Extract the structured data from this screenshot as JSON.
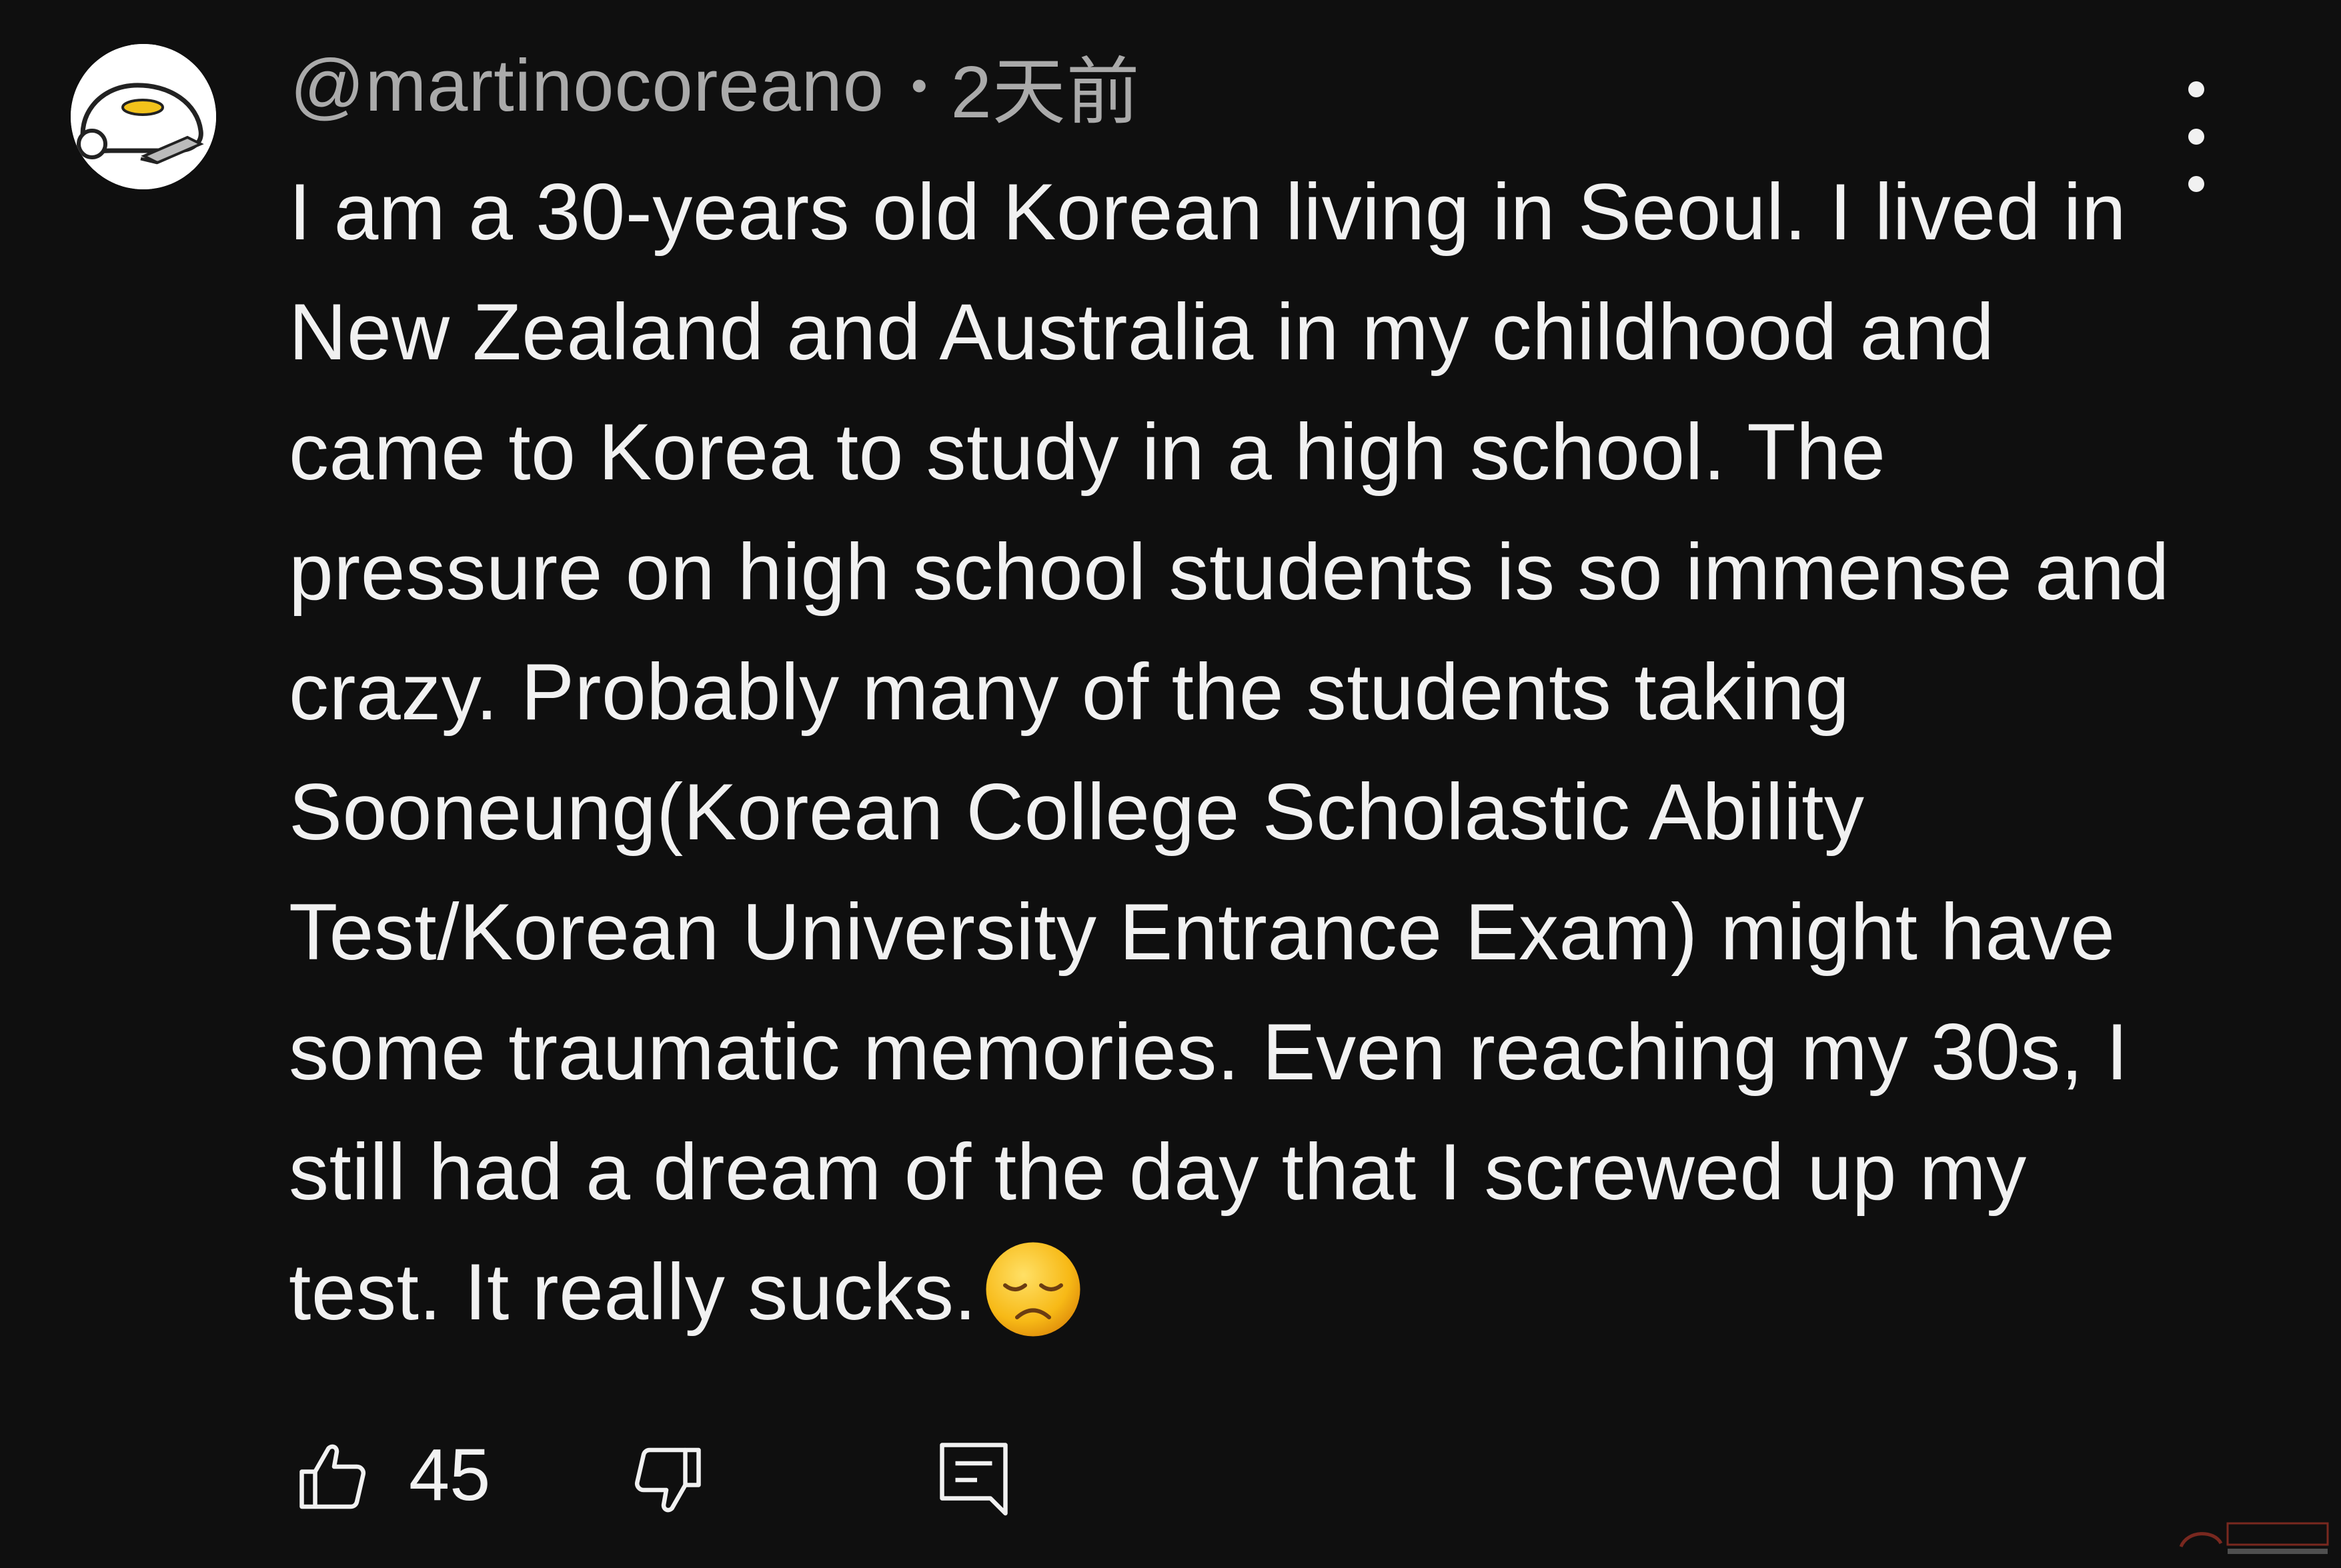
{
  "comment": {
    "author": "@martinocoreano",
    "separator": "•",
    "time": "2天前",
    "text": "I am a 30-years old Korean living in Seoul. I lived in New Zealand and Australia in my childhood and came to Korea to study in a high school. The pressure on high school students is so immense and crazy. Probably many of the students taking Sooneung(Korean College Scholastic Ability Test/Korean University Entrance Exam) might have some traumatic memories. Even reaching my 30s, I still had a dream of the day that I screwed up my test. It really sucks.",
    "emoji": "disappointed-face-emoji",
    "likes": "45"
  },
  "icons": {
    "menu": "more-vertical-icon",
    "like": "thumbs-up-icon",
    "dislike": "thumbs-down-icon",
    "reply": "reply-comment-icon"
  },
  "colors": {
    "background": "#0f0f0f",
    "text": "#f1f1f1",
    "meta": "#aaaaaa"
  }
}
